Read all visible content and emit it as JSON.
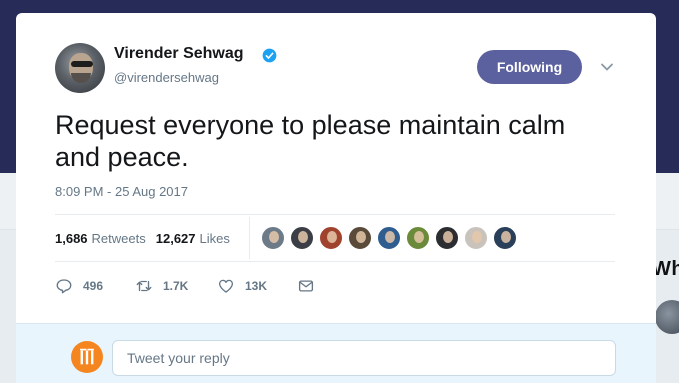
{
  "background": {
    "side_text": "Wh"
  },
  "tweet": {
    "author_name": "Virender Sehwag",
    "author_handle": "@virendersehwag",
    "verified": true,
    "follow_button_label": "Following",
    "text": "Request everyone to please maintain calm and peace.",
    "timestamp": "8:09 PM - 25 Aug 2017",
    "stats": {
      "retweets_count": "1,686",
      "retweets_label": "Retweets",
      "likes_count": "12,627",
      "likes_label": "Likes"
    },
    "likers": [
      {
        "color": "#6d7a88"
      },
      {
        "color": "#3b3f45"
      },
      {
        "color": "#a0432e"
      },
      {
        "color": "#5a4a3a"
      },
      {
        "color": "#2f5d8f"
      },
      {
        "color": "#6b8a3a"
      },
      {
        "color": "#2b2d30"
      },
      {
        "color": "#c9c3bc"
      },
      {
        "color": "#2a3f5a"
      }
    ],
    "actions": {
      "replies": "496",
      "retweets": "1.7K",
      "likes": "13K"
    }
  },
  "reply": {
    "placeholder": "Tweet your reply"
  },
  "colors": {
    "accent": "#5b609e",
    "verified": "#1da1f2",
    "text_secondary": "#657786"
  }
}
